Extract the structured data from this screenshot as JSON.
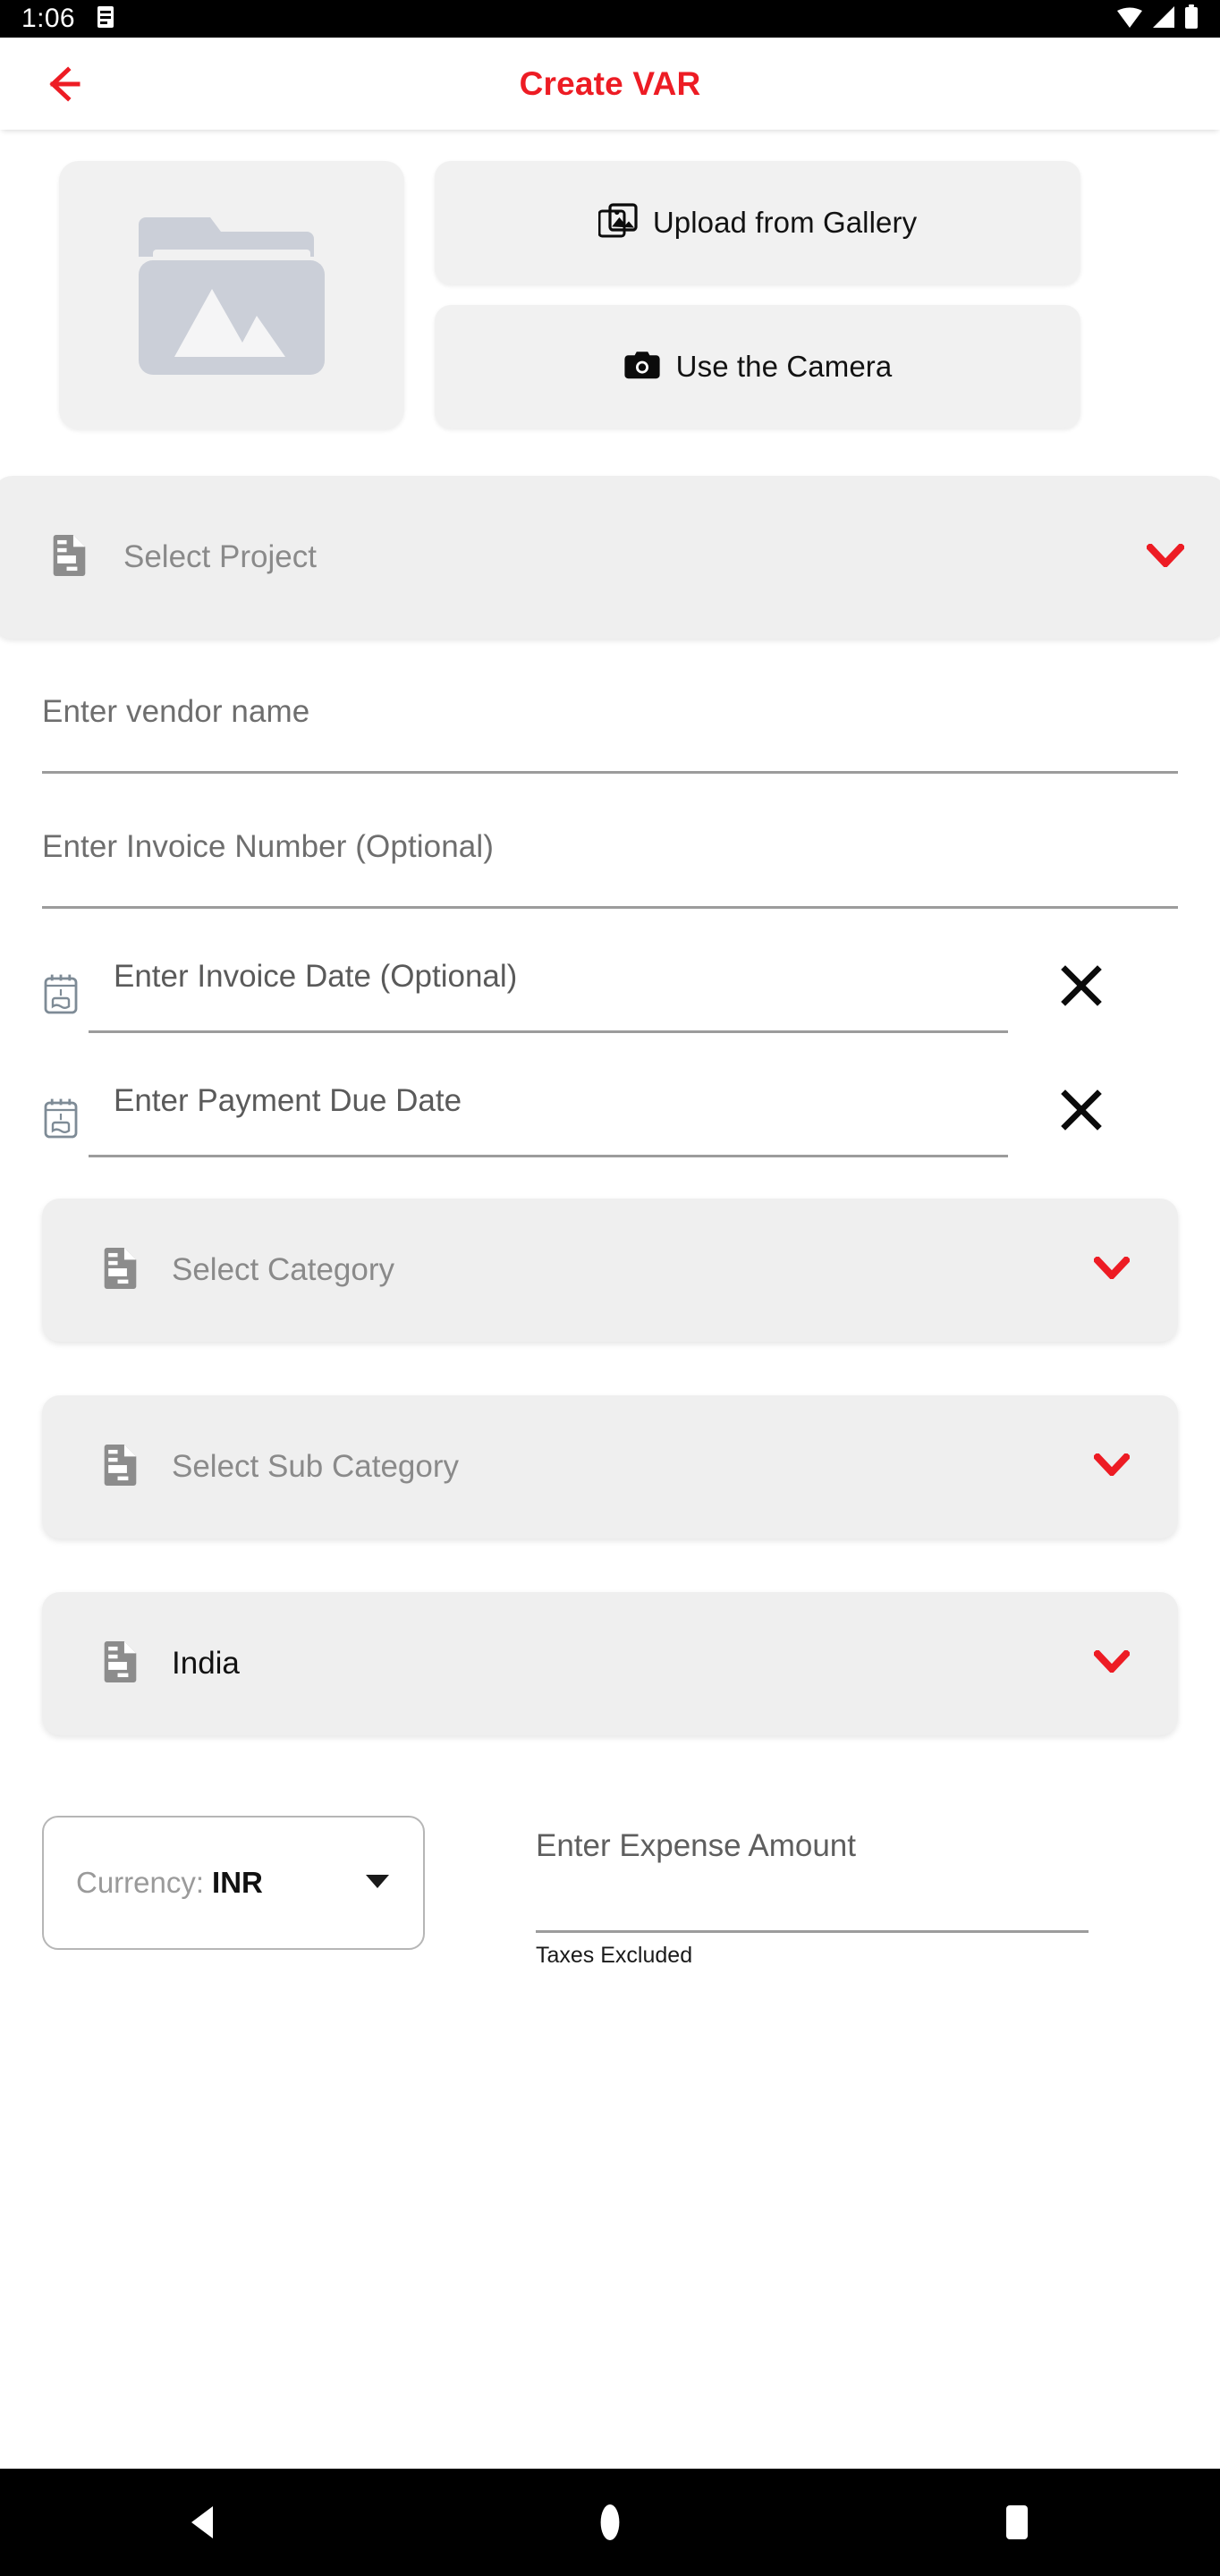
{
  "status_bar": {
    "time": "1:06",
    "icons": [
      "notification-icon",
      "wifi-icon",
      "signal-icon",
      "battery-icon"
    ]
  },
  "app_bar": {
    "back_icon": "back-arrow-icon",
    "title": "Create VAR",
    "title_color": "#ED1C24"
  },
  "upload": {
    "placeholder_icon": "folder-image-icon",
    "gallery_button": {
      "label": "Upload from Gallery",
      "icon": "gallery-image-icon"
    },
    "camera_button": {
      "label": "Use the Camera",
      "icon": "camera-icon"
    }
  },
  "form": {
    "project": {
      "label": "Select Project",
      "icon": "document-icon",
      "chevron": "chevron-down-icon",
      "chevron_color": "#ED1C24",
      "selected": false
    },
    "vendor_name": {
      "placeholder": "Enter vendor name",
      "value": ""
    },
    "invoice_number": {
      "placeholder": "Enter Invoice Number (Optional)",
      "value": ""
    },
    "invoice_date": {
      "placeholder": "Enter Invoice Date (Optional)",
      "value": "",
      "icon": "calendar-event-icon",
      "clear_icon": "close-x-icon"
    },
    "payment_due_date": {
      "placeholder": "Enter Payment Due Date",
      "value": "",
      "icon": "calendar-event-icon",
      "clear_icon": "close-x-icon"
    },
    "category": {
      "label": "Select Category",
      "icon": "document-icon",
      "chevron": "chevron-down-icon",
      "selected": false
    },
    "sub_category": {
      "label": "Select Sub Category",
      "icon": "document-icon",
      "chevron": "chevron-down-icon",
      "selected": false
    },
    "country": {
      "label": "India",
      "icon": "document-icon",
      "chevron": "chevron-down-icon",
      "selected": true
    },
    "currency": {
      "label": "Currency:",
      "value": "INR",
      "caret": "caret-down-icon"
    },
    "expense_amount": {
      "placeholder": "Enter Expense Amount",
      "value": "",
      "helper": "Taxes Excluded"
    }
  },
  "nav_bar": {
    "back": "nav-back-icon",
    "home": "nav-home-icon",
    "recents": "nav-recents-icon"
  }
}
